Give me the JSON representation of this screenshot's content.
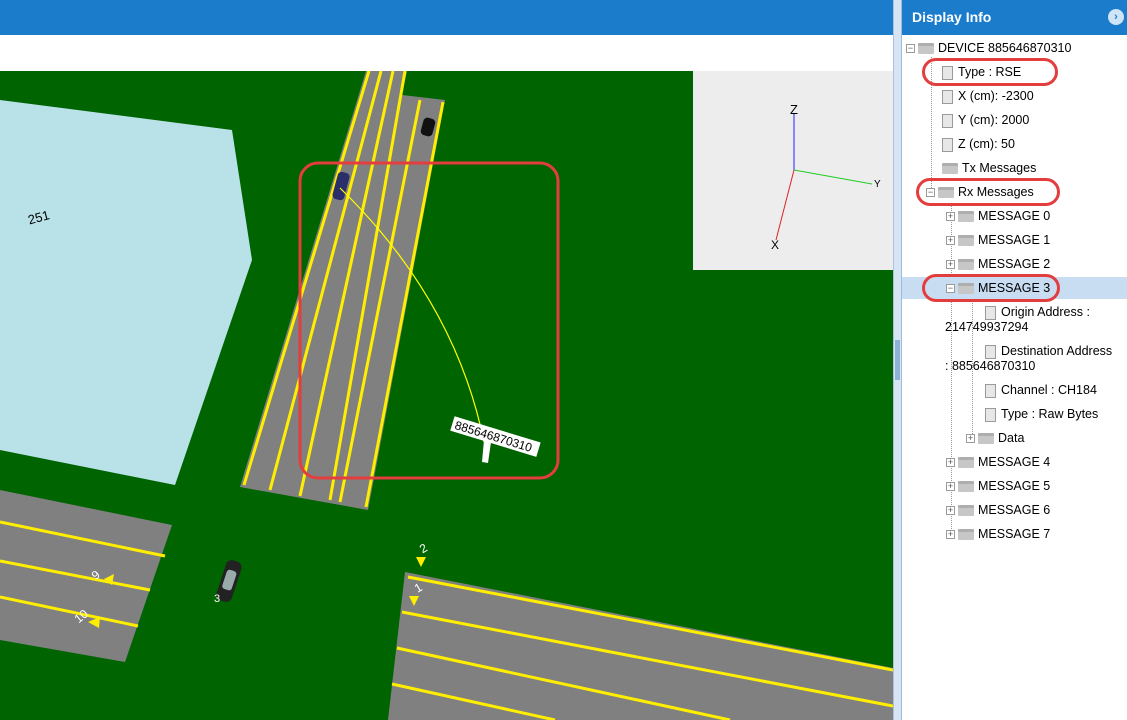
{
  "panel": {
    "title": "Display Info",
    "tree": {
      "device": "DEVICE 885646870310",
      "type": "Type : RSE",
      "x": "X (cm): -2300",
      "y": "Y (cm): 2000",
      "z": "Z (cm): 50",
      "tx": "Tx Messages",
      "rx": "Rx Messages",
      "messages": [
        "MESSAGE 0",
        "MESSAGE 1",
        "MESSAGE 2",
        "MESSAGE 3",
        "MESSAGE 4",
        "MESSAGE 5",
        "MESSAGE 6",
        "MESSAGE 7"
      ],
      "origin_label": "Origin Address :",
      "origin_value": "214749937294",
      "dest_label": "Destination Address",
      "dest_value": ": 885646870310",
      "channel": "Channel : CH184",
      "msg_type": "Type : Raw Bytes",
      "data": "Data"
    }
  },
  "scene": {
    "building_label": "251",
    "device_label": "885646870310",
    "marker_labels": [
      "2",
      "1",
      "9",
      "10"
    ],
    "vehicle_label": "3",
    "axis_labels": {
      "x": "X",
      "y": "Y",
      "z": "Z"
    },
    "colors": {
      "ground": "#006400",
      "road": "#808080",
      "lane": "#ffee00",
      "building": "#b8e2e8",
      "highlight": "#e33d3d"
    }
  }
}
